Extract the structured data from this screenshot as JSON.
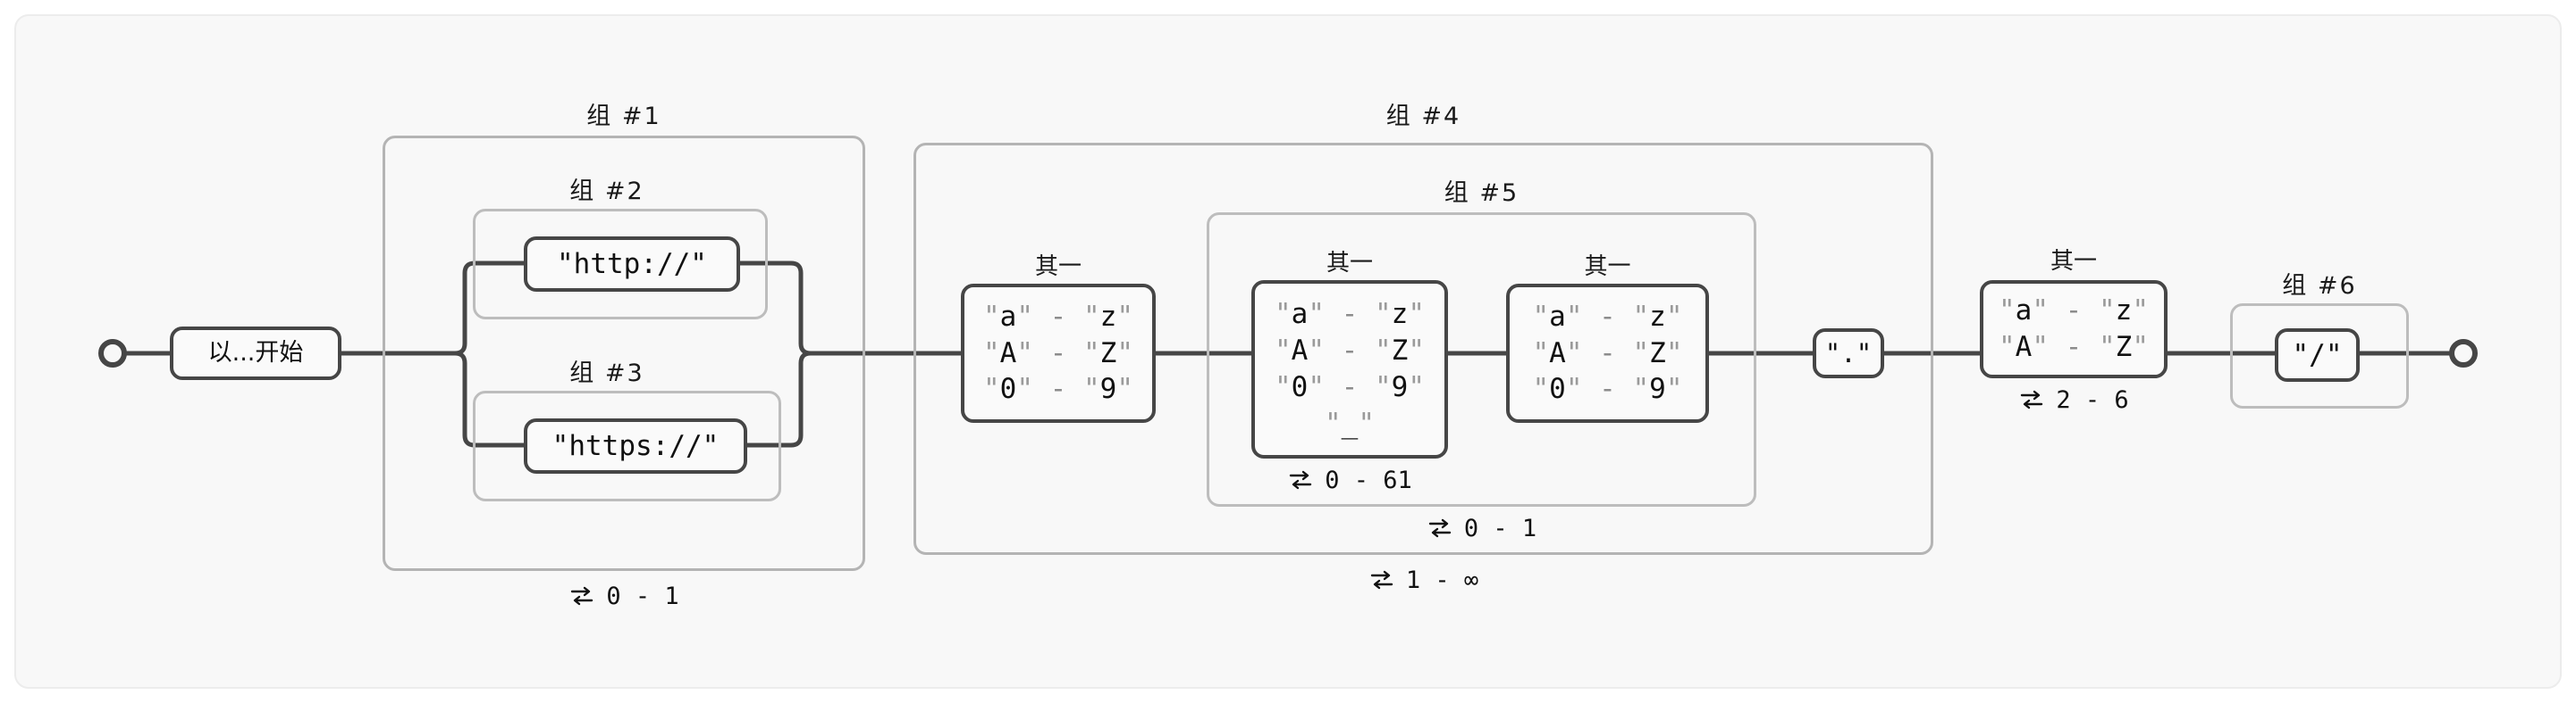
{
  "diagram": {
    "kind": "regex-railroad-diagram",
    "background": "#f8f8f8",
    "panel_border": "#ececec",
    "node_border": "#464646",
    "group_border": "#b4b4b4",
    "wire_color": "#464646"
  },
  "terminals": {
    "start_icon": "start-circle",
    "end_icon": "end-circle"
  },
  "anchor": {
    "label": "以...开始"
  },
  "group1": {
    "label": "组 #1",
    "quantifier": {
      "icon": "repeat-icon",
      "text": "0 - 1"
    }
  },
  "group2": {
    "label": "组 #2",
    "literal": "\"http://\""
  },
  "group3": {
    "label": "组 #3",
    "literal": "\"https://\""
  },
  "group4": {
    "label": "组 #4",
    "quantifier": {
      "icon": "repeat-icon",
      "text": "1 - ∞"
    }
  },
  "group5": {
    "label": "组 #5",
    "quantifier": {
      "icon": "repeat-icon",
      "text": "0 - 1"
    }
  },
  "group6": {
    "label": "组 #6",
    "literal": "\"/\""
  },
  "alt_caption": "其一",
  "charsets": {
    "set_a": {
      "caption": "其一",
      "rows": [
        {
          "from": "\"a\"",
          "dash": "-",
          "to": "\"z\""
        },
        {
          "from": "\"A\"",
          "dash": "-",
          "to": "\"Z\""
        },
        {
          "from": "\"0\"",
          "dash": "-",
          "to": "\"9\""
        }
      ]
    },
    "set_b": {
      "caption": "其一",
      "rows": [
        {
          "from": "\"a\"",
          "dash": "-",
          "to": "\"z\""
        },
        {
          "from": "\"A\"",
          "dash": "-",
          "to": "\"Z\""
        },
        {
          "from": "\"0\"",
          "dash": "-",
          "to": "\"9\""
        },
        {
          "single": "\"_\""
        }
      ],
      "quantifier": {
        "icon": "repeat-icon",
        "text": "0 - 61"
      }
    },
    "set_c": {
      "caption": "其一",
      "rows": [
        {
          "from": "\"a\"",
          "dash": "-",
          "to": "\"z\""
        },
        {
          "from": "\"A\"",
          "dash": "-",
          "to": "\"Z\""
        },
        {
          "from": "\"0\"",
          "dash": "-",
          "to": "\"9\""
        }
      ]
    },
    "set_d": {
      "caption": "其一",
      "rows": [
        {
          "from": "\"a\"",
          "dash": "-",
          "to": "\"z\""
        },
        {
          "from": "\"A\"",
          "dash": "-",
          "to": "\"Z\""
        }
      ],
      "quantifier": {
        "icon": "repeat-icon",
        "text": "2 - 6"
      }
    }
  },
  "dot_literal": {
    "text": "\".\""
  }
}
